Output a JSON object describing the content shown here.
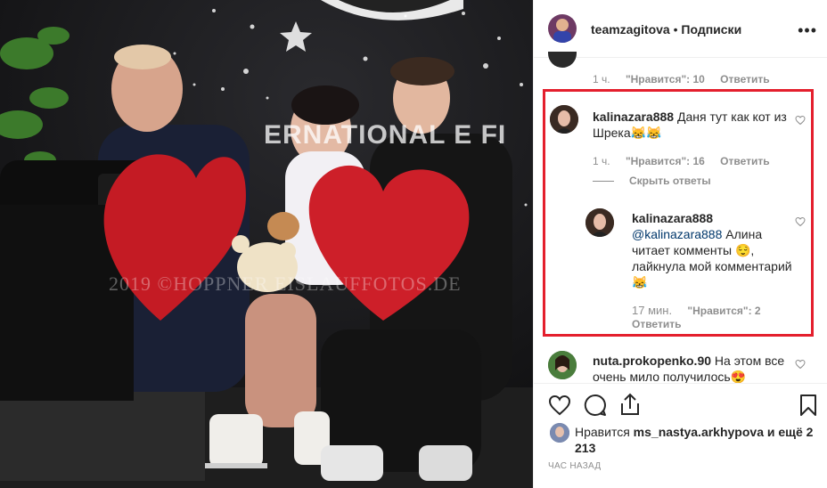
{
  "photo": {
    "watermark": "2019 ©HOPPNER   EISLAUFFOTOS.DE",
    "banner_text": "ERNATIONAL   E FI"
  },
  "header": {
    "username": "teamzagitova",
    "separator": " • ",
    "follow_label": "Подписки",
    "more_label": "•••"
  },
  "comments": {
    "top_partial": {
      "time": "1 ч.",
      "likes": "\"Нравится\": 10",
      "reply": "Ответить"
    },
    "c1": {
      "username": "kalinazara888",
      "text": "Даня тут как кот из Шрека😹😹",
      "time": "1 ч.",
      "likes": "\"Нравится\": 16",
      "reply": "Ответить",
      "hide_replies": "Скрыть ответы"
    },
    "c1_reply": {
      "username": "kalinazara888",
      "mention": "@kalinazara888",
      "text": "Алина читает комменты 😌, лайкнула мой комментарий😹",
      "time": "17 мин.",
      "likes": "\"Нравится\": 2",
      "reply": "Ответить"
    },
    "c2": {
      "username": "nuta.prokopenko.90",
      "text": "На этом все очень мило получилось😍"
    }
  },
  "actions": {
    "like_icon": "heart-icon",
    "comment_icon": "comment-icon",
    "share_icon": "share-icon",
    "save_icon": "bookmark-icon"
  },
  "likes_line": {
    "prefix": "Нравится",
    "user": "ms_nastya.arkhypova",
    "suffix": "и ещё 2 213"
  },
  "post_time": "ЧАС НАЗАД",
  "colors": {
    "highlight": "#e41f2d",
    "secondary_text": "#8e8e8e",
    "link": "#00376b"
  }
}
